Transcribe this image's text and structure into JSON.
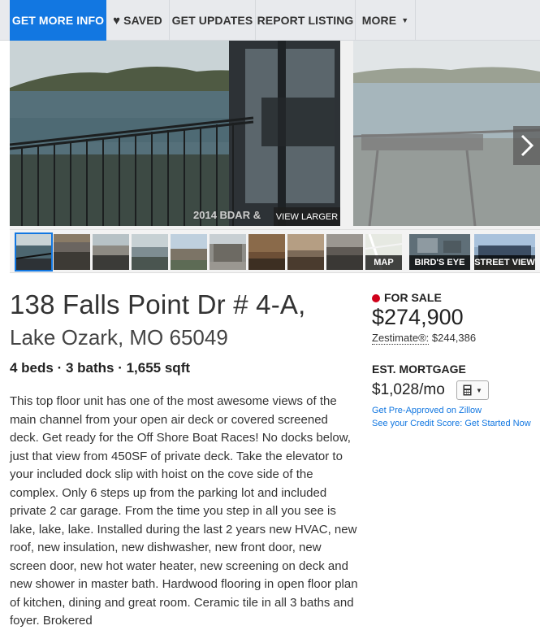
{
  "nav": {
    "get_more_info": "GET MORE INFO",
    "saved": "SAVED",
    "get_updates": "GET UPDATES",
    "report_listing": "REPORT LISTING",
    "more": "MORE"
  },
  "photos": {
    "watermark": "2014 BDAR &",
    "view_larger": "VIEW LARGER",
    "thumb_labels": {
      "map": "MAP",
      "birds_eye": "BIRD'S EYE",
      "street_view": "STREET VIEW"
    }
  },
  "listing": {
    "address_line1": "138 Falls Point Dr # 4-A,",
    "address_line2": "Lake Ozark, MO 65049",
    "facts": "4 beds · 3 baths · 1,655 sqft",
    "description": "This top floor unit has one of the most awesome views of the main channel from your open air deck or covered screened deck. Get ready for the Off Shore Boat Races! No docks below, just that view from 450SF of private deck. Take the elevator to your included dock slip with hoist on the cove side of the complex. Only 6 steps up from the parking lot and included private 2 car garage. From the time you step in all you see is lake, lake, lake. Installed during the last 2 years new HVAC, new roof, new insulation, new dishwasher, new front door, new screen door, new hot water heater, new screening on deck and new shower in master bath. Hardwood flooring in open floor plan of kitchen, dining and great room. Ceramic tile in all 3 baths and foyer. Brokered"
  },
  "summary": {
    "status": "FOR SALE",
    "price": "$274,900",
    "zestimate_label": "Zestimate®:",
    "zestimate_value": "$244,386",
    "est_mortgage_label": "EST. MORTGAGE",
    "mortgage_value": "$1,028/mo",
    "preapproved_link": "Get Pre-Approved on Zillow",
    "credit_link": "See your Credit Score: Get Started Now"
  },
  "colors": {
    "accent": "#1277e1",
    "status_red": "#d0021b"
  }
}
